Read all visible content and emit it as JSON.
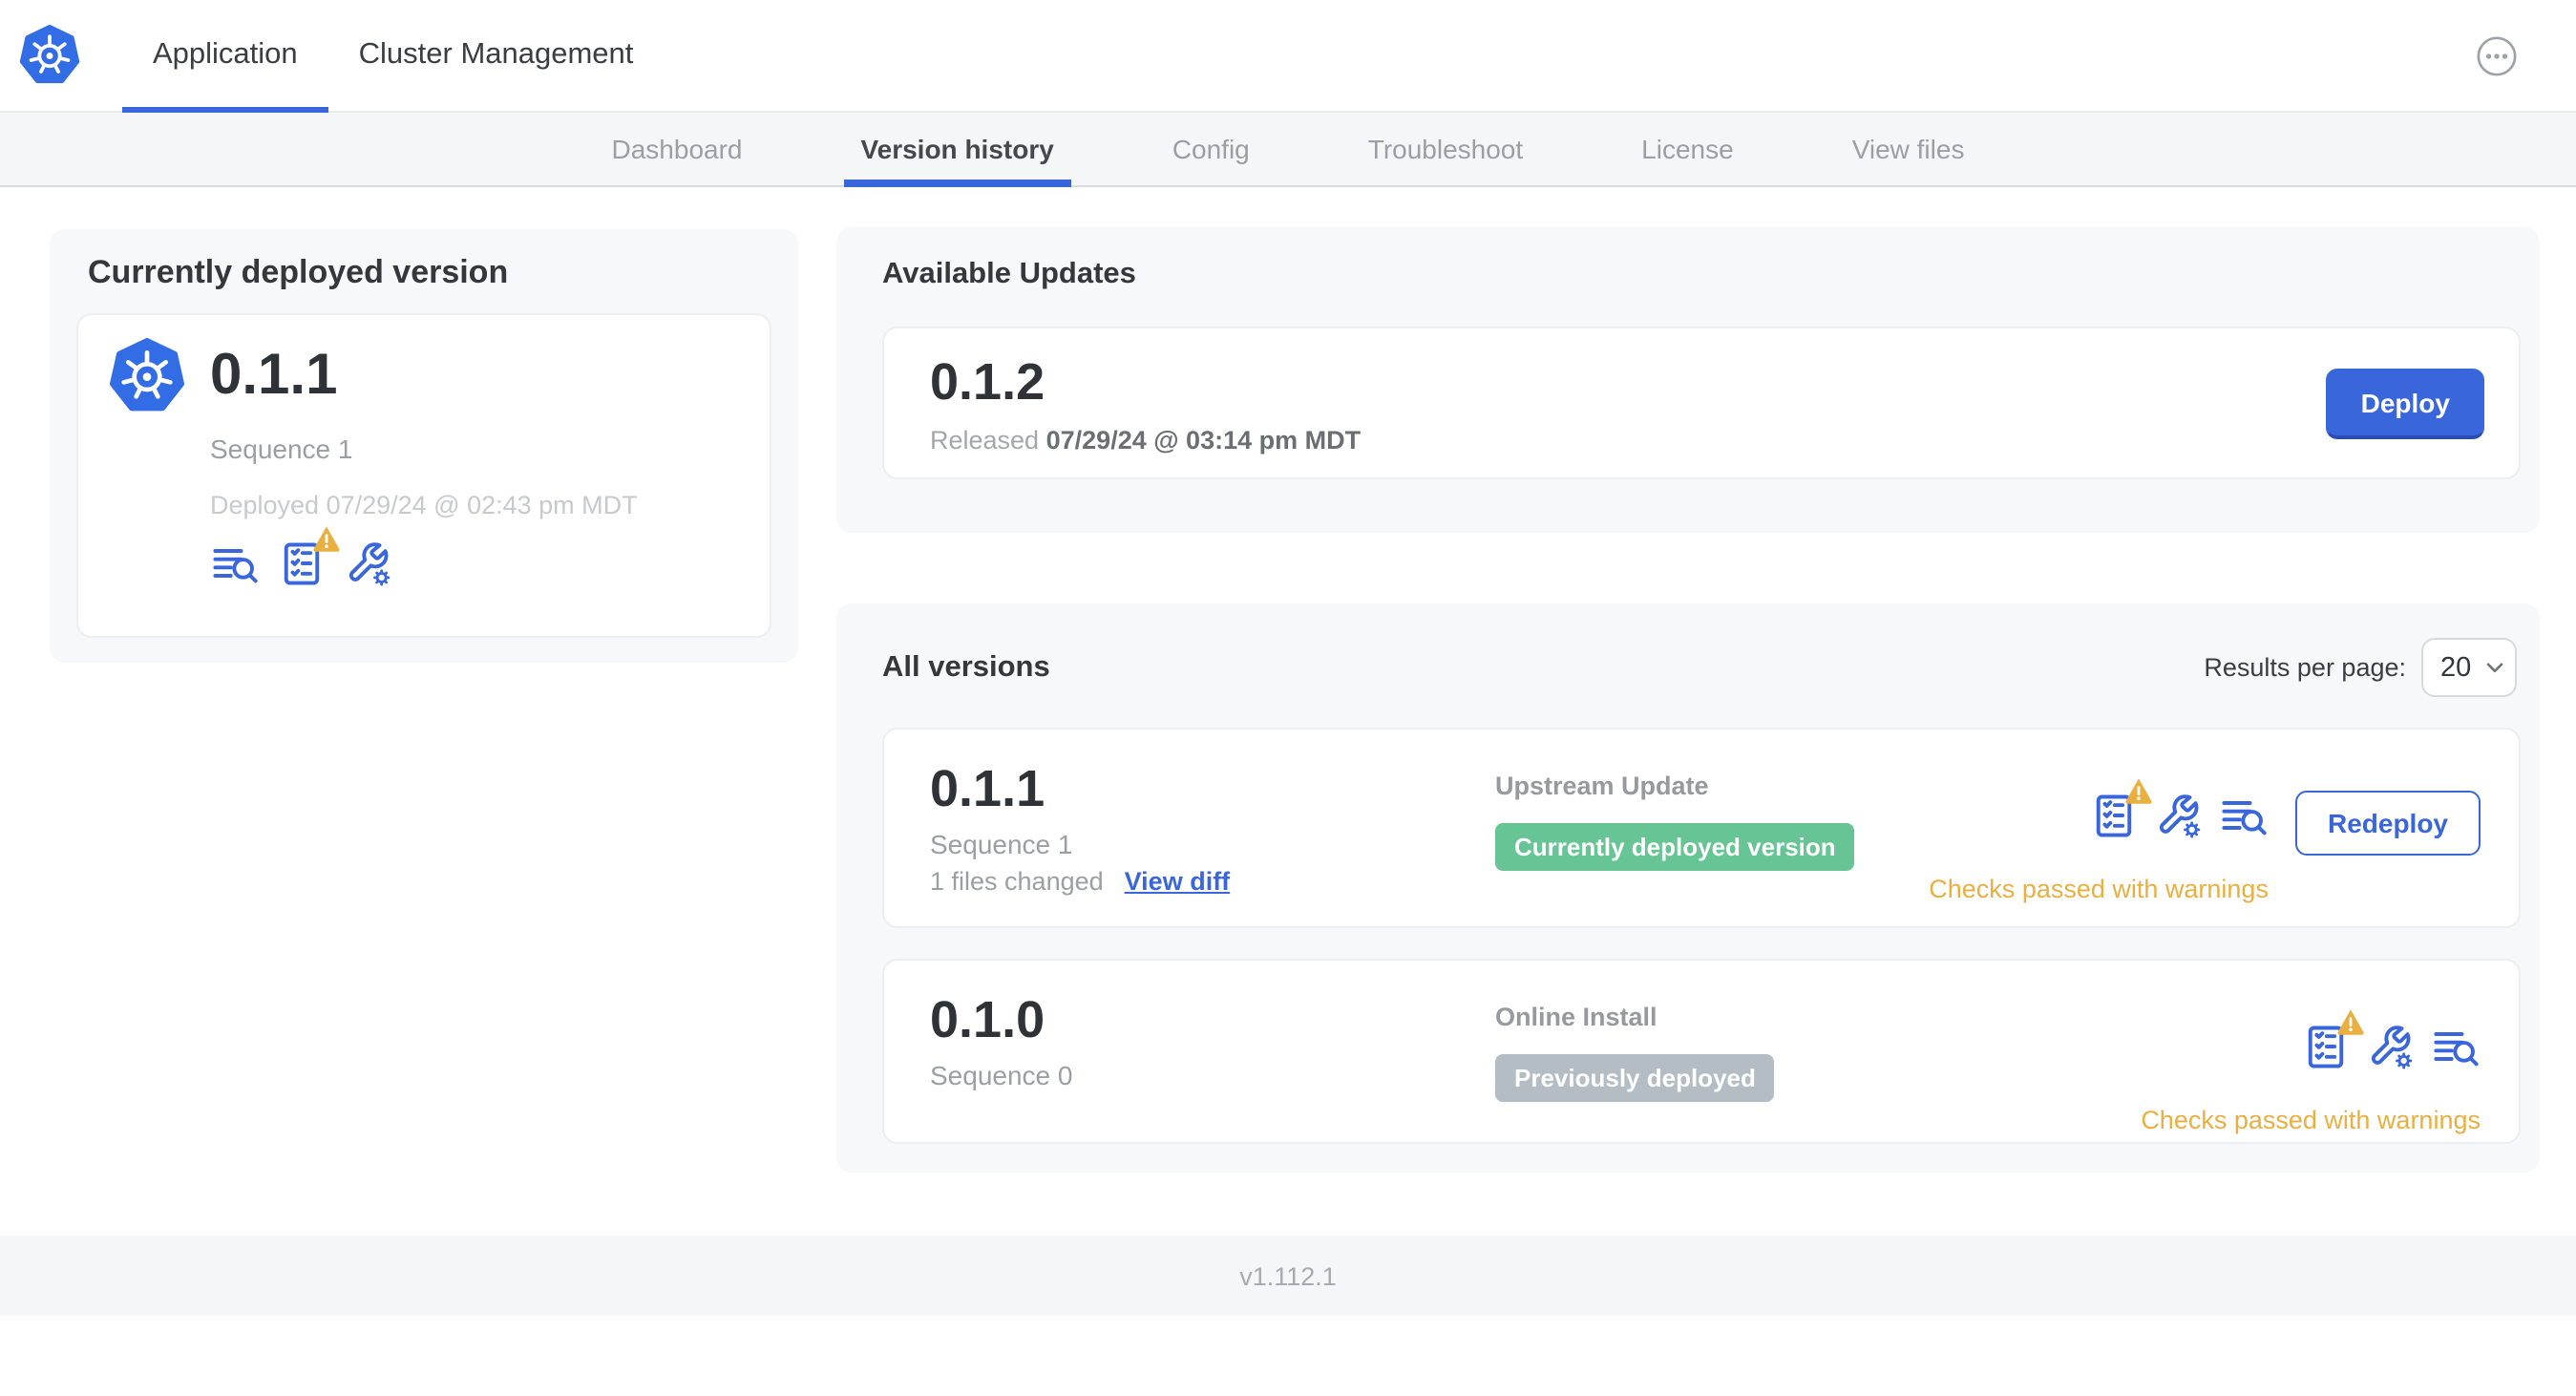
{
  "colors": {
    "accent_blue": "#3A66DB",
    "k8s_logo_blue": "#326DE6",
    "badge_green": "#67C494",
    "badge_gray": "#B3BDC3",
    "warning_amber": "#E9AF41"
  },
  "topbar": {
    "tabs": [
      {
        "label": "Application",
        "active": true
      },
      {
        "label": "Cluster Management",
        "active": false
      }
    ],
    "menu_icon": "ellipsis-in-circle-icon"
  },
  "subnav": {
    "tabs": [
      {
        "label": "Dashboard",
        "active": false
      },
      {
        "label": "Version history",
        "active": true
      },
      {
        "label": "Config",
        "active": false
      },
      {
        "label": "Troubleshoot",
        "active": false
      },
      {
        "label": "License",
        "active": false
      },
      {
        "label": "View files",
        "active": false
      }
    ]
  },
  "current_version_card": {
    "title": "Currently deployed version",
    "version": "0.1.1",
    "sequence": "Sequence 1",
    "deployed": "Deployed 07/29/24 @ 02:43 pm MDT",
    "icons": [
      "view-logs-icon",
      "preflight-checks-icon-with-warning",
      "edit-config-icon"
    ]
  },
  "available_updates": {
    "title": "Available Updates",
    "update": {
      "version": "0.1.2",
      "released_label": "Released",
      "released_date": "07/29/24 @ 03:14 pm MDT",
      "deploy_label": "Deploy"
    }
  },
  "all_versions": {
    "title": "All versions",
    "results_per_page_label": "Results per page:",
    "results_per_page_value": "20",
    "versions": [
      {
        "version": "0.1.1",
        "sequence": "Sequence 1",
        "files_changed": "1 files changed",
        "view_diff_label": "View diff",
        "source": "Upstream Update",
        "badge": "Currently deployed version",
        "badge_color": "green",
        "icons": [
          "preflight-checks-icon-with-warning",
          "edit-config-icon",
          "view-logs-icon"
        ],
        "status": "Checks passed with warnings",
        "action_label": "Redeploy"
      },
      {
        "version": "0.1.0",
        "sequence": "Sequence 0",
        "source": "Online Install",
        "badge": "Previously deployed",
        "badge_color": "gray",
        "icons": [
          "preflight-checks-icon-with-warning",
          "edit-config-icon",
          "view-logs-icon"
        ],
        "status": "Checks passed with warnings"
      }
    ]
  },
  "footer": {
    "app_version": "v1.112.1"
  }
}
